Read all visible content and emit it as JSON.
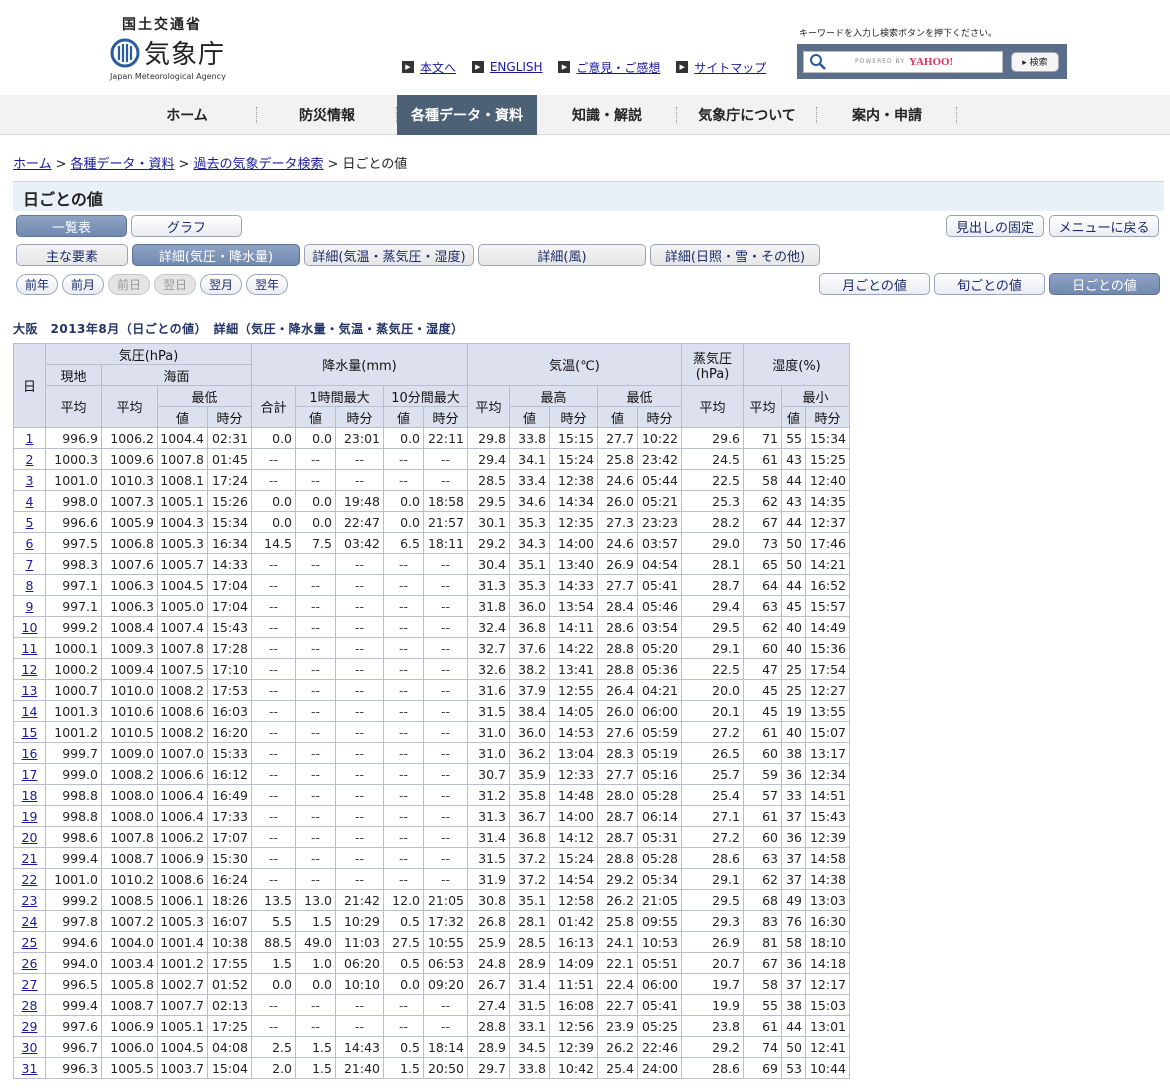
{
  "header": {
    "ministry": "国土交通省",
    "agency_name": "気象庁",
    "agency_en": "Japan Meteorological Agency",
    "util_links": [
      {
        "icon": "square-arrow-icon",
        "label": "本文へ"
      },
      {
        "icon": "square-arrow-icon",
        "label": "ENGLISH"
      },
      {
        "icon": "square-arrow-icon",
        "label": "ご意見・ご感想"
      },
      {
        "icon": "square-arrow-icon",
        "label": "サイトマップ"
      }
    ],
    "search": {
      "prompt": "キーワードを入力し検索ボタンを押下ください。",
      "powered_by": "POWERED BY",
      "yahoo": "YAHOO!",
      "button": "▸ 検索"
    }
  },
  "nav": {
    "items": [
      "ホーム",
      "防災情報",
      "各種データ・資料",
      "知識・解説",
      "気象庁について",
      "案内・申請"
    ],
    "active_index": 2
  },
  "breadcrumb": {
    "items": [
      "ホーム",
      "各種データ・資料",
      "過去の気象データ検索"
    ],
    "current": "日ごとの値"
  },
  "page_title": "日ごとの値",
  "buttons": {
    "view": [
      "一覧表",
      "グラフ"
    ],
    "fix_header": "見出しの固定",
    "back_menu": "メニューに戻る",
    "elements": [
      "主な要素",
      "詳細(気圧・降水量)",
      "詳細(気温・蒸気圧・湿度)",
      "詳細(風)",
      "詳細(日照・雪・その他)"
    ],
    "date_nav": [
      "前年",
      "前月",
      "前日",
      "翌日",
      "翌月",
      "翌年"
    ],
    "period": [
      "月ごとの値",
      "旬ごとの値",
      "日ごとの値"
    ]
  },
  "table_title": "大阪　2013年8月（日ごとの値）　詳細（気圧・降水量・気温・蒸気圧・湿度）",
  "table": {
    "h": {
      "day": "日",
      "pressure": "気圧(hPa)",
      "station": "現地",
      "sea": "海面",
      "min": "最低",
      "max": "最高",
      "avg": "平均",
      "value": "値",
      "time": "時分",
      "precip": "降水量(mm)",
      "total": "合計",
      "hour_max": "1時間最大",
      "ten_max": "10分間最大",
      "temp": "気温(℃)",
      "vapor1": "蒸気圧",
      "vapor2": "(hPa)",
      "humidity": "湿度(%)",
      "hmin": "最小"
    },
    "rows": [
      [
        "1",
        "996.9",
        "1006.2",
        "1004.4",
        "02:31",
        "0.0",
        "0.0",
        "23:01",
        "0.0",
        "22:11",
        "29.8",
        "33.8",
        "15:15",
        "27.7",
        "10:22",
        "29.6",
        "71",
        "55",
        "15:34"
      ],
      [
        "2",
        "1000.3",
        "1009.6",
        "1007.8",
        "01:45",
        "--",
        "--",
        "--",
        "--",
        "--",
        "29.4",
        "34.1",
        "15:24",
        "25.8",
        "23:42",
        "24.5",
        "61",
        "43",
        "15:25"
      ],
      [
        "3",
        "1001.0",
        "1010.3",
        "1008.1",
        "17:24",
        "--",
        "--",
        "--",
        "--",
        "--",
        "28.5",
        "33.4",
        "12:38",
        "24.6",
        "05:44",
        "22.5",
        "58",
        "44",
        "12:40"
      ],
      [
        "4",
        "998.0",
        "1007.3",
        "1005.1",
        "15:26",
        "0.0",
        "0.0",
        "19:48",
        "0.0",
        "18:58",
        "29.5",
        "34.6",
        "14:34",
        "26.0",
        "05:21",
        "25.3",
        "62",
        "43",
        "14:35"
      ],
      [
        "5",
        "996.6",
        "1005.9",
        "1004.3",
        "15:34",
        "0.0",
        "0.0",
        "22:47",
        "0.0",
        "21:57",
        "30.1",
        "35.3",
        "12:35",
        "27.3",
        "23:23",
        "28.2",
        "67",
        "44",
        "12:37"
      ],
      [
        "6",
        "997.5",
        "1006.8",
        "1005.3",
        "16:34",
        "14.5",
        "7.5",
        "03:42",
        "6.5",
        "18:11",
        "29.2",
        "34.3",
        "14:00",
        "24.6",
        "03:57",
        "29.0",
        "73",
        "50",
        "17:46"
      ],
      [
        "7",
        "998.3",
        "1007.6",
        "1005.7",
        "14:33",
        "--",
        "--",
        "--",
        "--",
        "--",
        "30.4",
        "35.1",
        "13:40",
        "26.9",
        "04:54",
        "28.1",
        "65",
        "50",
        "14:21"
      ],
      [
        "8",
        "997.1",
        "1006.3",
        "1004.5",
        "17:04",
        "--",
        "--",
        "--",
        "--",
        "--",
        "31.3",
        "35.3",
        "14:33",
        "27.7",
        "05:41",
        "28.7",
        "64",
        "44",
        "16:52"
      ],
      [
        "9",
        "997.1",
        "1006.3",
        "1005.0",
        "17:04",
        "--",
        "--",
        "--",
        "--",
        "--",
        "31.8",
        "36.0",
        "13:54",
        "28.4",
        "05:46",
        "29.4",
        "63",
        "45",
        "15:57"
      ],
      [
        "10",
        "999.2",
        "1008.4",
        "1007.4",
        "15:43",
        "--",
        "--",
        "--",
        "--",
        "--",
        "32.4",
        "36.8",
        "14:11",
        "28.6",
        "03:54",
        "29.5",
        "62",
        "40",
        "14:49"
      ],
      [
        "11",
        "1000.1",
        "1009.3",
        "1007.8",
        "17:28",
        "--",
        "--",
        "--",
        "--",
        "--",
        "32.7",
        "37.6",
        "14:22",
        "28.8",
        "05:20",
        "29.1",
        "60",
        "40",
        "15:36"
      ],
      [
        "12",
        "1000.2",
        "1009.4",
        "1007.5",
        "17:10",
        "--",
        "--",
        "--",
        "--",
        "--",
        "32.6",
        "38.2",
        "13:41",
        "28.8",
        "05:36",
        "22.5",
        "47",
        "25",
        "17:54"
      ],
      [
        "13",
        "1000.7",
        "1010.0",
        "1008.2",
        "17:53",
        "--",
        "--",
        "--",
        "--",
        "--",
        "31.6",
        "37.9",
        "12:55",
        "26.4",
        "04:21",
        "20.0",
        "45",
        "25",
        "12:27"
      ],
      [
        "14",
        "1001.3",
        "1010.6",
        "1008.6",
        "16:03",
        "--",
        "--",
        "--",
        "--",
        "--",
        "31.5",
        "38.4",
        "14:05",
        "26.0",
        "06:00",
        "20.1",
        "45",
        "19",
        "13:55"
      ],
      [
        "15",
        "1001.2",
        "1010.5",
        "1008.2",
        "16:20",
        "--",
        "--",
        "--",
        "--",
        "--",
        "31.0",
        "36.0",
        "14:53",
        "27.6",
        "05:59",
        "27.2",
        "61",
        "40",
        "15:07"
      ],
      [
        "16",
        "999.7",
        "1009.0",
        "1007.0",
        "15:33",
        "--",
        "--",
        "--",
        "--",
        "--",
        "31.0",
        "36.2",
        "13:04",
        "28.3",
        "05:19",
        "26.5",
        "60",
        "38",
        "13:17"
      ],
      [
        "17",
        "999.0",
        "1008.2",
        "1006.6",
        "16:12",
        "--",
        "--",
        "--",
        "--",
        "--",
        "30.7",
        "35.9",
        "12:33",
        "27.7",
        "05:16",
        "25.7",
        "59",
        "36",
        "12:34"
      ],
      [
        "18",
        "998.8",
        "1008.0",
        "1006.4",
        "16:49",
        "--",
        "--",
        "--",
        "--",
        "--",
        "31.2",
        "35.8",
        "14:48",
        "28.0",
        "05:28",
        "25.4",
        "57",
        "33",
        "14:51"
      ],
      [
        "19",
        "998.8",
        "1008.0",
        "1006.4",
        "17:33",
        "--",
        "--",
        "--",
        "--",
        "--",
        "31.3",
        "36.7",
        "14:00",
        "28.7",
        "06:14",
        "27.1",
        "61",
        "37",
        "15:43"
      ],
      [
        "20",
        "998.6",
        "1007.8",
        "1006.2",
        "17:07",
        "--",
        "--",
        "--",
        "--",
        "--",
        "31.4",
        "36.8",
        "14:12",
        "28.7",
        "05:31",
        "27.2",
        "60",
        "36",
        "12:39"
      ],
      [
        "21",
        "999.4",
        "1008.7",
        "1006.9",
        "15:30",
        "--",
        "--",
        "--",
        "--",
        "--",
        "31.5",
        "37.2",
        "15:24",
        "28.8",
        "05:28",
        "28.6",
        "63",
        "37",
        "14:58"
      ],
      [
        "22",
        "1001.0",
        "1010.2",
        "1008.6",
        "16:24",
        "--",
        "--",
        "--",
        "--",
        "--",
        "31.9",
        "37.2",
        "14:54",
        "29.2",
        "05:34",
        "29.1",
        "62",
        "37",
        "14:38"
      ],
      [
        "23",
        "999.2",
        "1008.5",
        "1006.1",
        "18:26",
        "13.5",
        "13.0",
        "21:42",
        "12.0",
        "21:05",
        "30.8",
        "35.1",
        "12:58",
        "26.2",
        "21:05",
        "29.5",
        "68",
        "49",
        "13:03"
      ],
      [
        "24",
        "997.8",
        "1007.2",
        "1005.3",
        "16:07",
        "5.5",
        "1.5",
        "10:29",
        "0.5",
        "17:32",
        "26.8",
        "28.1",
        "01:42",
        "25.8",
        "09:55",
        "29.3",
        "83",
        "76",
        "16:30"
      ],
      [
        "25",
        "994.6",
        "1004.0",
        "1001.4",
        "10:38",
        "88.5",
        "49.0",
        "11:03",
        "27.5",
        "10:55",
        "25.9",
        "28.5",
        "16:13",
        "24.1",
        "10:53",
        "26.9",
        "81",
        "58",
        "18:10"
      ],
      [
        "26",
        "994.0",
        "1003.4",
        "1001.2",
        "17:55",
        "1.5",
        "1.0",
        "06:20",
        "0.5",
        "06:53",
        "24.8",
        "28.9",
        "14:09",
        "22.1",
        "05:51",
        "20.7",
        "67",
        "36",
        "14:18"
      ],
      [
        "27",
        "996.5",
        "1005.8",
        "1002.7",
        "01:52",
        "0.0",
        "0.0",
        "10:10",
        "0.0",
        "09:20",
        "26.7",
        "31.4",
        "11:51",
        "22.4",
        "06:00",
        "19.7",
        "58",
        "37",
        "12:17"
      ],
      [
        "28",
        "999.4",
        "1008.7",
        "1007.7",
        "02:13",
        "--",
        "--",
        "--",
        "--",
        "--",
        "27.4",
        "31.5",
        "16:08",
        "22.7",
        "05:41",
        "19.9",
        "55",
        "38",
        "15:03"
      ],
      [
        "29",
        "997.6",
        "1006.9",
        "1005.1",
        "17:25",
        "--",
        "--",
        "--",
        "--",
        "--",
        "28.8",
        "33.1",
        "12:56",
        "23.9",
        "05:25",
        "23.8",
        "61",
        "44",
        "13:01"
      ],
      [
        "30",
        "996.7",
        "1006.0",
        "1004.5",
        "04:08",
        "2.5",
        "1.5",
        "14:43",
        "0.5",
        "18:14",
        "28.9",
        "34.5",
        "12:39",
        "26.2",
        "22:46",
        "29.2",
        "74",
        "50",
        "12:41"
      ],
      [
        "31",
        "996.3",
        "1005.5",
        "1003.7",
        "15:04",
        "2.0",
        "1.5",
        "21:40",
        "1.5",
        "20:50",
        "29.7",
        "33.8",
        "10:42",
        "25.4",
        "24:00",
        "28.6",
        "69",
        "53",
        "10:44"
      ]
    ]
  }
}
